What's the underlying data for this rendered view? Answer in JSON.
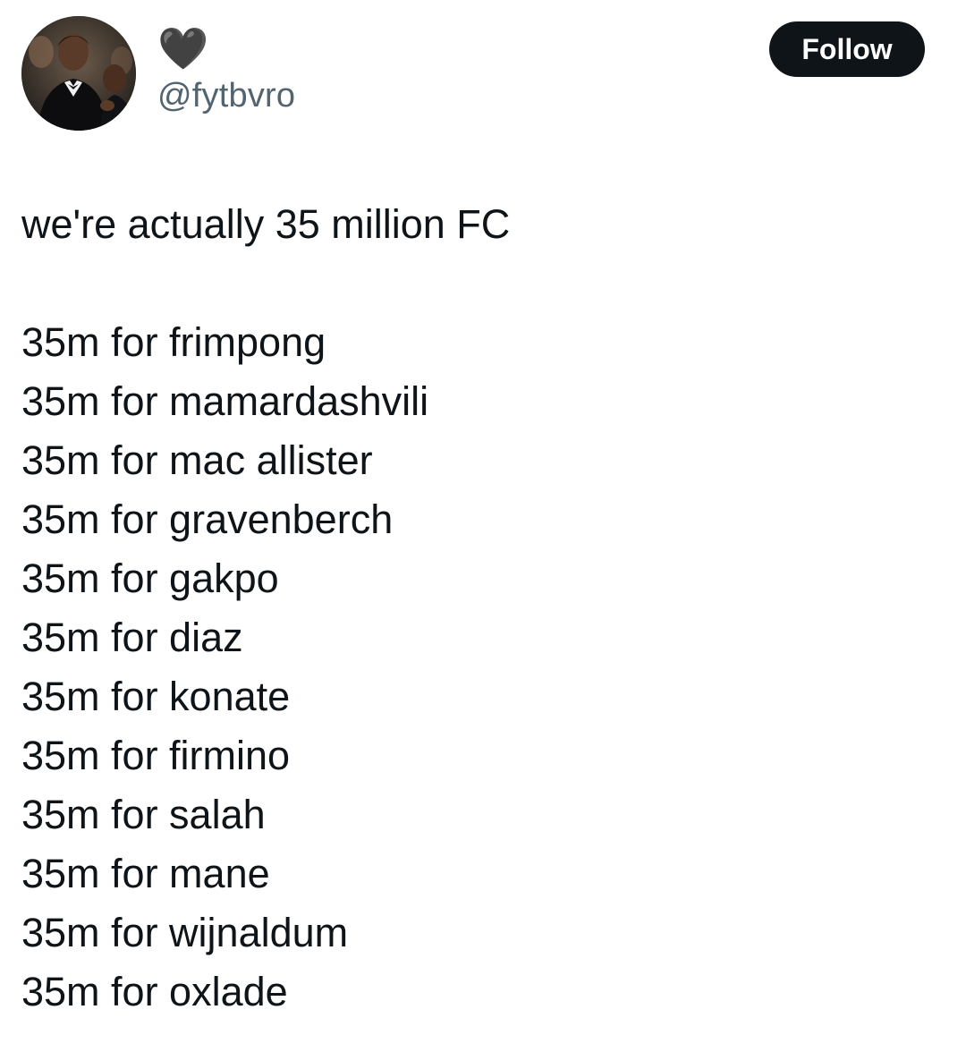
{
  "tweet": {
    "display_name_icon": "black-heart-icon",
    "display_name": "🖤",
    "handle": "@fytbvro",
    "follow_label": "Follow",
    "headline": "we're actually 35 million FC",
    "lines": [
      "35m for frimpong",
      "35m for mamardashvili",
      "35m for mac allister",
      "35m for gravenberch",
      "35m for gakpo",
      "35m for diaz",
      "35m for konate",
      "35m for firmino",
      "35m for salah",
      "35m for mane",
      "35m for wijnaldum",
      "35m for oxlade"
    ]
  },
  "colors": {
    "text": "#0f1419",
    "secondary": "#536471",
    "button_bg": "#0f1419",
    "button_text": "#ffffff"
  }
}
